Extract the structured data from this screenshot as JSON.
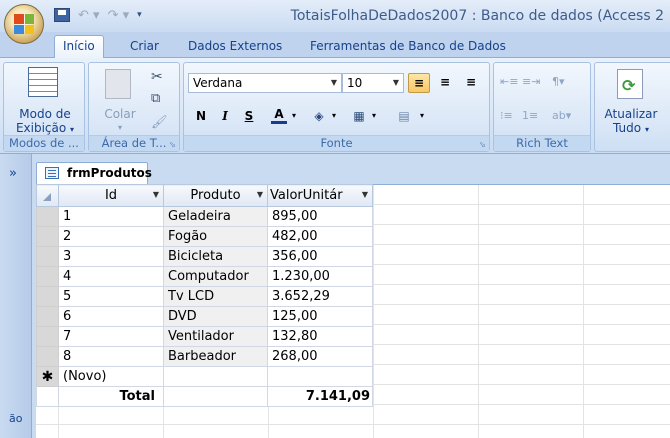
{
  "window": {
    "title": "TotaisFolhaDeDados2007 : Banco de dados (Access 2"
  },
  "ribbon_tabs": [
    "Início",
    "Criar",
    "Dados Externos",
    "Ferramentas de Banco de Dados"
  ],
  "groups": {
    "views": {
      "label": "Modos de ...",
      "button_line1": "Modo de",
      "button_line2": "Exibição"
    },
    "clipboard": {
      "label": "Área de T...",
      "paste_label": "Colar"
    },
    "font": {
      "label": "Fonte",
      "font_name": "Verdana",
      "font_size": "10",
      "bold": "N",
      "italic": "I",
      "underline": "S",
      "font_color_letter": "A"
    },
    "richtext": {
      "label": "Rich Text"
    },
    "records": {
      "button_line1": "Atualizar",
      "button_line2": "Tudo"
    }
  },
  "nav": {
    "toggle": "»",
    "vertical_text": "ão"
  },
  "document": {
    "tab_title": "frmProdutos",
    "columns": [
      "Id",
      "Produto",
      "ValorUnitár"
    ],
    "rows": [
      {
        "id": "1",
        "produto": "Geladeira",
        "valor": "895,00"
      },
      {
        "id": "2",
        "produto": "Fogão",
        "valor": "482,00"
      },
      {
        "id": "3",
        "produto": "Bicicleta",
        "valor": "356,00"
      },
      {
        "id": "4",
        "produto": "Computador",
        "valor": "1.230,00"
      },
      {
        "id": "5",
        "produto": "Tv LCD",
        "valor": "3.652,29"
      },
      {
        "id": "6",
        "produto": "DVD",
        "valor": "125,00"
      },
      {
        "id": "7",
        "produto": "Ventilador",
        "valor": "132,80"
      },
      {
        "id": "8",
        "produto": "Barbeador",
        "valor": "268,00"
      }
    ],
    "new_row_marker": "✱",
    "new_row_text": "(Novo)",
    "total_label": "Total",
    "total_value": "7.141,09"
  },
  "colors": {
    "ribbon_blue": "#c5d7ee",
    "tab_text": "#15428b",
    "highlight": "#f8c766"
  }
}
